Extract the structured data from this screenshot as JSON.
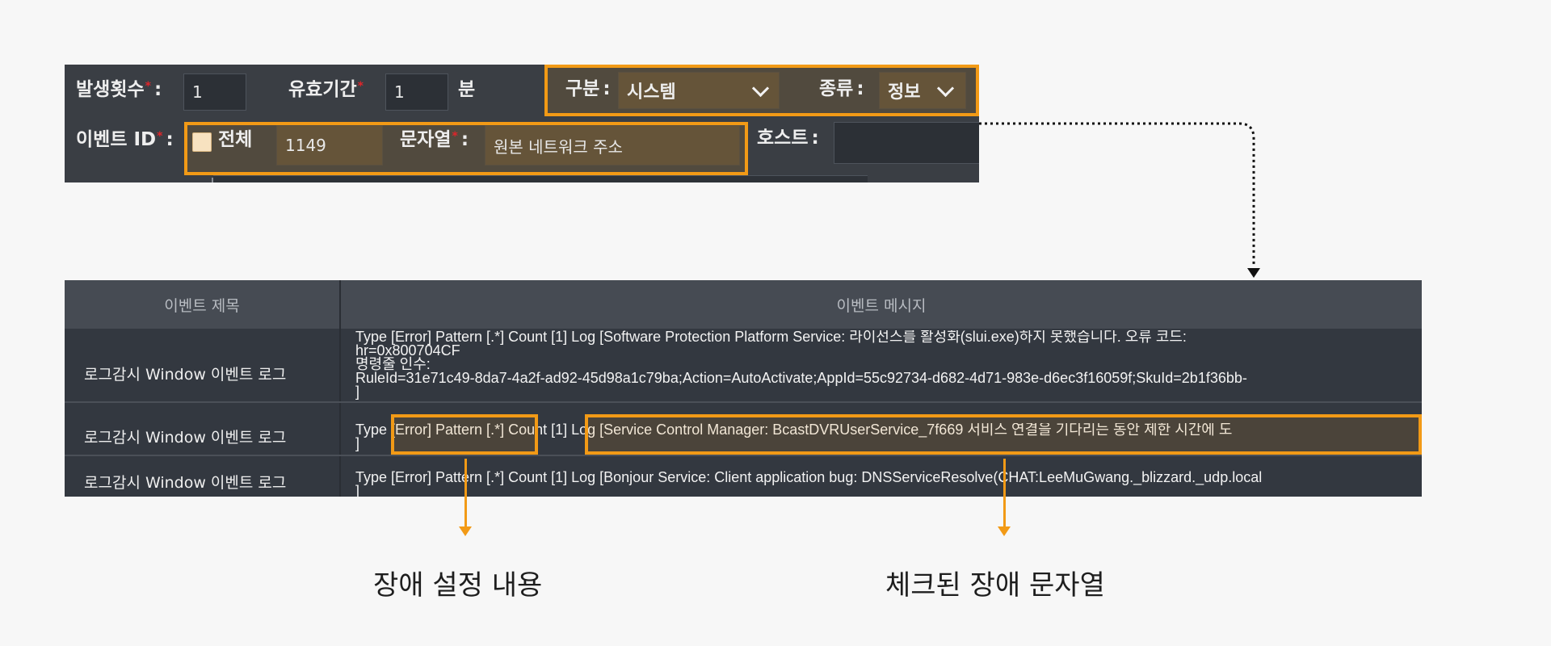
{
  "filter": {
    "occurrence_label": "발생횟수",
    "occurrence_value": "1",
    "validity_label": "유효기간",
    "validity_value": "1",
    "validity_unit": "분",
    "category_label": "구분",
    "category_value": "시스템",
    "type_label": "종류",
    "type_value": "정보",
    "event_id_label": "이벤트 ID",
    "all_label": "전체",
    "event_id_value": "1149",
    "string_label": "문자열",
    "string_value": "원본 네트워크 주소",
    "host_label": "호스트",
    "host_value": ""
  },
  "table": {
    "col_title": "이벤트 제목",
    "col_message": "이벤트 메시지",
    "rows": [
      {
        "title": "로그감시 Window 이벤트 로그",
        "message": "Type [Error] Pattern [.*] Count [1] Log [Software Protection Platform Service: 라이선스를 활성화(slui.exe)하지 못했습니다. 오류 코드:\nhr=0x800704CF\n명령줄 인수:\nRuleId=31e71c49-8da7-4a2f-ad92-45d98a1c79ba;Action=AutoActivate;AppId=55c92734-d682-4d71-983e-d6ec3f16059f;SkuId=2b1f36bb-\n]"
      },
      {
        "title": "로그감시 Window 이벤트 로그",
        "message": "Type [Error] Pattern [.*] Count [1] Log [Service Control Manager: BcastDVRUserService_7f669 서비스 연결을 기다리는 동안 제한 시간에 도\n]"
      },
      {
        "title": "로그감시 Window 이벤트 로그",
        "message": "Type [Error] Pattern [.*] Count [1] Log [Bonjour Service: Client application bug: DNSServiceResolve(CHAT:LeeMuGwang._blizzard._udp.local\n]"
      }
    ]
  },
  "annotations": {
    "left_caption": "장애 설정 내용",
    "right_caption": "체크된 장애 문자열"
  },
  "colors": {
    "accent": "#f29a16",
    "panel_bg": "#3a3e44",
    "table_bg": "#333840",
    "required_mark": "#e0252a"
  }
}
